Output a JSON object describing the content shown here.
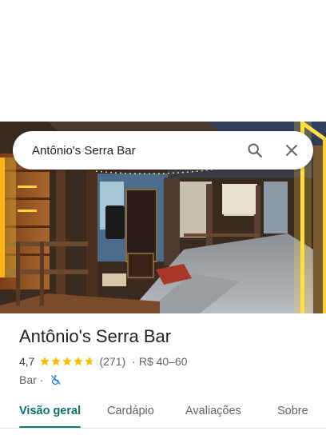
{
  "search": {
    "query": "Antônio's Serra Bar",
    "search_icon": "search-icon",
    "close_icon": "close-icon"
  },
  "place": {
    "name": "Antônio's Serra Bar",
    "rating": "4,7",
    "rating_value": 4.7,
    "stars_max": 5,
    "review_count": "(271)",
    "separator": "·",
    "price_range": "R$ 40–60",
    "category": "Bar",
    "accessibility_icon": "no-wheelchair-icon"
  },
  "tabs": [
    {
      "label": "Visão geral",
      "active": true
    },
    {
      "label": "Cardápio",
      "active": false
    },
    {
      "label": "Avaliações",
      "active": false
    },
    {
      "label": "Sobre",
      "active": false
    }
  ],
  "colors": {
    "accent": "#0b7a7a",
    "star": "#fbbc04",
    "neon": "#ffd23a"
  }
}
